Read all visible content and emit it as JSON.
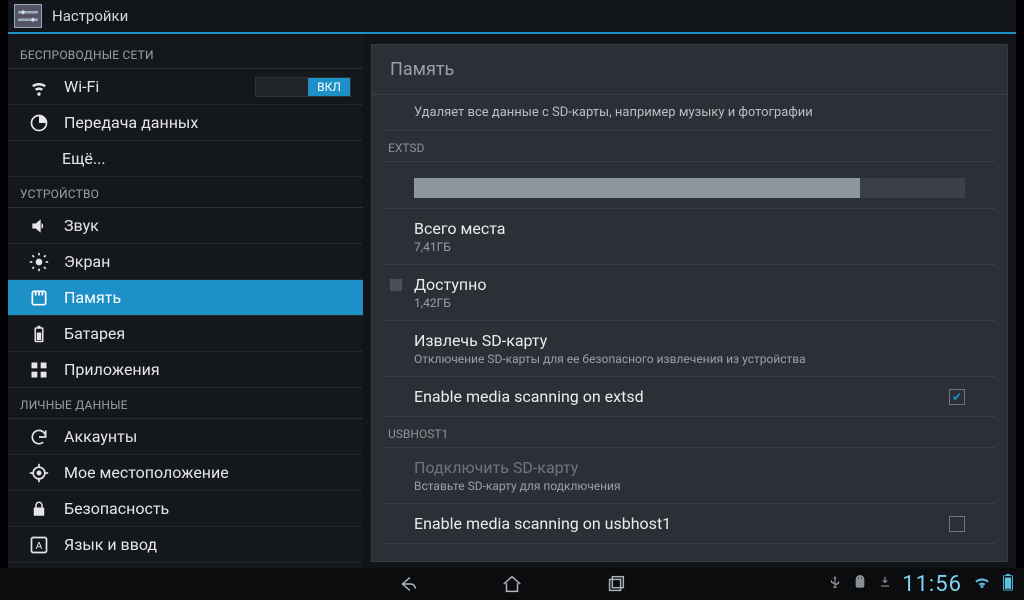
{
  "app": {
    "title": "Настройки"
  },
  "sidebar": {
    "sections": [
      {
        "header": "БЕСПРОВОДНЫЕ СЕТИ",
        "items": [
          {
            "id": "wifi",
            "label": "Wi-Fi",
            "icon": "wifi-icon",
            "toggle": "ВКЛ"
          },
          {
            "id": "data",
            "label": "Передача данных",
            "icon": "data-icon"
          },
          {
            "id": "more",
            "label": "Ещё...",
            "icon": null
          }
        ]
      },
      {
        "header": "УСТРОЙСТВО",
        "items": [
          {
            "id": "sound",
            "label": "Звук",
            "icon": "sound-icon"
          },
          {
            "id": "display",
            "label": "Экран",
            "icon": "display-icon"
          },
          {
            "id": "storage",
            "label": "Память",
            "icon": "storage-icon",
            "selected": true
          },
          {
            "id": "battery",
            "label": "Батарея",
            "icon": "battery-icon"
          },
          {
            "id": "apps",
            "label": "Приложения",
            "icon": "apps-icon"
          }
        ]
      },
      {
        "header": "ЛИЧНЫЕ ДАННЫЕ",
        "items": [
          {
            "id": "accounts",
            "label": "Аккаунты",
            "icon": "sync-icon"
          },
          {
            "id": "location",
            "label": "Мое местоположение",
            "icon": "location-icon"
          },
          {
            "id": "security",
            "label": "Безопасность",
            "icon": "lock-icon"
          },
          {
            "id": "language",
            "label": "Язык и ввод",
            "icon": "language-icon"
          }
        ]
      }
    ]
  },
  "content": {
    "title": "Память",
    "erase_desc": "Удаляет все данные с SD-карты, например музыку и фотографии",
    "extsd": {
      "label": "EXTSD",
      "used_pct": 81,
      "total": {
        "title": "Всего места",
        "value": "7,41ГБ"
      },
      "avail": {
        "title": "Доступно",
        "value": "1,42ГБ",
        "swatch": "#4a5056"
      },
      "eject": {
        "title": "Извлечь SD-карту",
        "sub": "Отключение SD-карты для ее безопасного извлечения из устройства"
      },
      "scan": {
        "title": "Enable media scanning on extsd",
        "checked": true
      }
    },
    "usbhost1": {
      "label": "USBHOST1",
      "mount": {
        "title": "Подключить SD-карту",
        "sub": "Вставьте SD-карту для подключения",
        "disabled": true
      },
      "scan": {
        "title": "Enable media scanning on usbhost1",
        "checked": false
      }
    }
  },
  "status": {
    "clock": "11:56"
  }
}
